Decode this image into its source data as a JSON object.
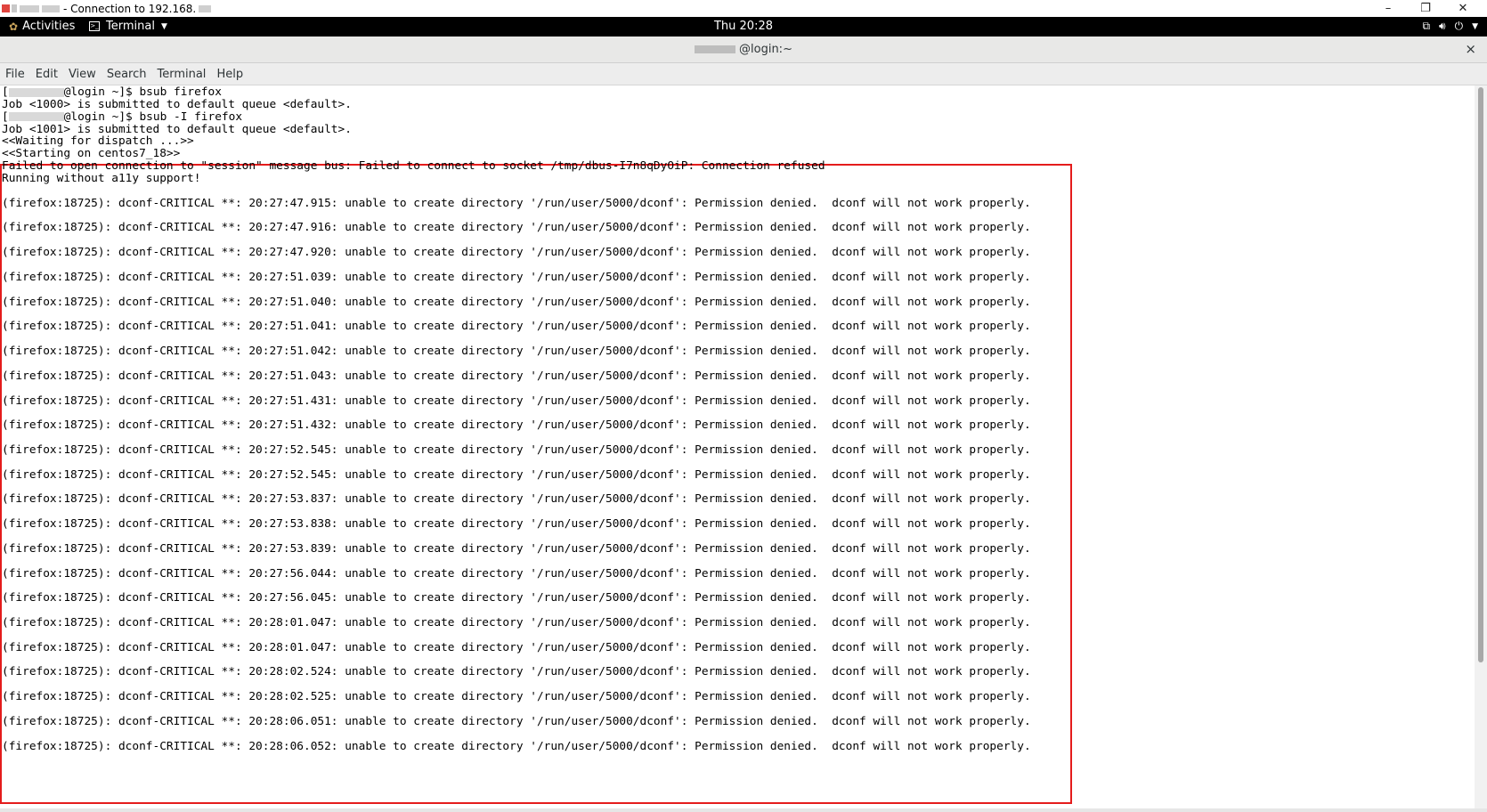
{
  "rdp": {
    "title": "- Connection to 192.168.",
    "controls": {
      "minimize": "–",
      "restore": "❐",
      "close": "✕"
    }
  },
  "gnome": {
    "activities": "Activities",
    "app_menu": "Terminal",
    "clock": "Thu 20:28"
  },
  "terminal": {
    "window_title": "@login:~",
    "close": "×",
    "menu": [
      "File",
      "Edit",
      "View",
      "Search",
      "Terminal",
      "Help"
    ],
    "lines": [
      "@login ~]$ bsub firefox",
      "Job <1000> is submitted to default queue <default>.",
      "@login ~]$ bsub -I firefox",
      "Job <1001> is submitted to default queue <default>.",
      "<<Waiting for dispatch ...>>",
      "<<Starting on centos7_18>>",
      "Failed to open connection to \"session\" message bus: Failed to connect to socket /tmp/dbus-I7n8qDyOiP: Connection refused",
      "Running without a11y support!",
      "",
      "(firefox:18725): dconf-CRITICAL **: 20:27:47.915: unable to create directory '/run/user/5000/dconf': Permission denied.  dconf will not work properly.",
      "",
      "(firefox:18725): dconf-CRITICAL **: 20:27:47.916: unable to create directory '/run/user/5000/dconf': Permission denied.  dconf will not work properly.",
      "",
      "(firefox:18725): dconf-CRITICAL **: 20:27:47.920: unable to create directory '/run/user/5000/dconf': Permission denied.  dconf will not work properly.",
      "",
      "(firefox:18725): dconf-CRITICAL **: 20:27:51.039: unable to create directory '/run/user/5000/dconf': Permission denied.  dconf will not work properly.",
      "",
      "(firefox:18725): dconf-CRITICAL **: 20:27:51.040: unable to create directory '/run/user/5000/dconf': Permission denied.  dconf will not work properly.",
      "",
      "(firefox:18725): dconf-CRITICAL **: 20:27:51.041: unable to create directory '/run/user/5000/dconf': Permission denied.  dconf will not work properly.",
      "",
      "(firefox:18725): dconf-CRITICAL **: 20:27:51.042: unable to create directory '/run/user/5000/dconf': Permission denied.  dconf will not work properly.",
      "",
      "(firefox:18725): dconf-CRITICAL **: 20:27:51.043: unable to create directory '/run/user/5000/dconf': Permission denied.  dconf will not work properly.",
      "",
      "(firefox:18725): dconf-CRITICAL **: 20:27:51.431: unable to create directory '/run/user/5000/dconf': Permission denied.  dconf will not work properly.",
      "",
      "(firefox:18725): dconf-CRITICAL **: 20:27:51.432: unable to create directory '/run/user/5000/dconf': Permission denied.  dconf will not work properly.",
      "",
      "(firefox:18725): dconf-CRITICAL **: 20:27:52.545: unable to create directory '/run/user/5000/dconf': Permission denied.  dconf will not work properly.",
      "",
      "(firefox:18725): dconf-CRITICAL **: 20:27:52.545: unable to create directory '/run/user/5000/dconf': Permission denied.  dconf will not work properly.",
      "",
      "(firefox:18725): dconf-CRITICAL **: 20:27:53.837: unable to create directory '/run/user/5000/dconf': Permission denied.  dconf will not work properly.",
      "",
      "(firefox:18725): dconf-CRITICAL **: 20:27:53.838: unable to create directory '/run/user/5000/dconf': Permission denied.  dconf will not work properly.",
      "",
      "(firefox:18725): dconf-CRITICAL **: 20:27:53.839: unable to create directory '/run/user/5000/dconf': Permission denied.  dconf will not work properly.",
      "",
      "(firefox:18725): dconf-CRITICAL **: 20:27:56.044: unable to create directory '/run/user/5000/dconf': Permission denied.  dconf will not work properly.",
      "",
      "(firefox:18725): dconf-CRITICAL **: 20:27:56.045: unable to create directory '/run/user/5000/dconf': Permission denied.  dconf will not work properly.",
      "",
      "(firefox:18725): dconf-CRITICAL **: 20:28:01.047: unable to create directory '/run/user/5000/dconf': Permission denied.  dconf will not work properly.",
      "",
      "(firefox:18725): dconf-CRITICAL **: 20:28:01.047: unable to create directory '/run/user/5000/dconf': Permission denied.  dconf will not work properly.",
      "",
      "(firefox:18725): dconf-CRITICAL **: 20:28:02.524: unable to create directory '/run/user/5000/dconf': Permission denied.  dconf will not work properly.",
      "",
      "(firefox:18725): dconf-CRITICAL **: 20:28:02.525: unable to create directory '/run/user/5000/dconf': Permission denied.  dconf will not work properly.",
      "",
      "(firefox:18725): dconf-CRITICAL **: 20:28:06.051: unable to create directory '/run/user/5000/dconf': Permission denied.  dconf will not work properly.",
      "",
      "(firefox:18725): dconf-CRITICAL **: 20:28:06.052: unable to create directory '/run/user/5000/dconf': Permission denied.  dconf will not work properly."
    ]
  },
  "colors": {
    "highlight": "#e41c1c",
    "gnome_bar": "#000000",
    "terminal_bg": "#ffffff"
  }
}
